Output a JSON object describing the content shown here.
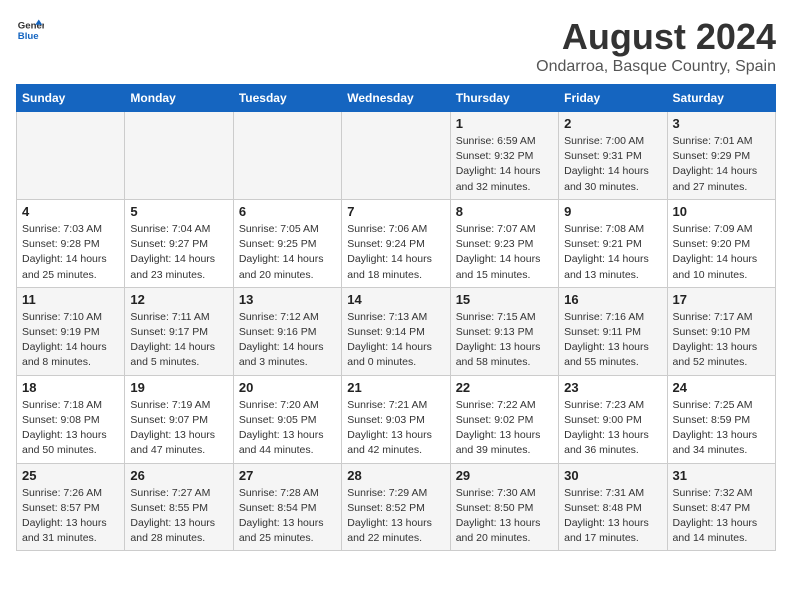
{
  "header": {
    "logo_general": "General",
    "logo_blue": "Blue",
    "title": "August 2024",
    "subtitle": "Ondarroa, Basque Country, Spain"
  },
  "days_of_week": [
    "Sunday",
    "Monday",
    "Tuesday",
    "Wednesday",
    "Thursday",
    "Friday",
    "Saturday"
  ],
  "weeks": [
    [
      {
        "day": "",
        "sunrise": "",
        "sunset": "",
        "daylight": "",
        "empty": true
      },
      {
        "day": "",
        "sunrise": "",
        "sunset": "",
        "daylight": "",
        "empty": true
      },
      {
        "day": "",
        "sunrise": "",
        "sunset": "",
        "daylight": "",
        "empty": true
      },
      {
        "day": "",
        "sunrise": "",
        "sunset": "",
        "daylight": "",
        "empty": true
      },
      {
        "day": "1",
        "sunrise": "Sunrise: 6:59 AM",
        "sunset": "Sunset: 9:32 PM",
        "daylight": "Daylight: 14 hours and 32 minutes."
      },
      {
        "day": "2",
        "sunrise": "Sunrise: 7:00 AM",
        "sunset": "Sunset: 9:31 PM",
        "daylight": "Daylight: 14 hours and 30 minutes."
      },
      {
        "day": "3",
        "sunrise": "Sunrise: 7:01 AM",
        "sunset": "Sunset: 9:29 PM",
        "daylight": "Daylight: 14 hours and 27 minutes."
      }
    ],
    [
      {
        "day": "4",
        "sunrise": "Sunrise: 7:03 AM",
        "sunset": "Sunset: 9:28 PM",
        "daylight": "Daylight: 14 hours and 25 minutes."
      },
      {
        "day": "5",
        "sunrise": "Sunrise: 7:04 AM",
        "sunset": "Sunset: 9:27 PM",
        "daylight": "Daylight: 14 hours and 23 minutes."
      },
      {
        "day": "6",
        "sunrise": "Sunrise: 7:05 AM",
        "sunset": "Sunset: 9:25 PM",
        "daylight": "Daylight: 14 hours and 20 minutes."
      },
      {
        "day": "7",
        "sunrise": "Sunrise: 7:06 AM",
        "sunset": "Sunset: 9:24 PM",
        "daylight": "Daylight: 14 hours and 18 minutes."
      },
      {
        "day": "8",
        "sunrise": "Sunrise: 7:07 AM",
        "sunset": "Sunset: 9:23 PM",
        "daylight": "Daylight: 14 hours and 15 minutes."
      },
      {
        "day": "9",
        "sunrise": "Sunrise: 7:08 AM",
        "sunset": "Sunset: 9:21 PM",
        "daylight": "Daylight: 14 hours and 13 minutes."
      },
      {
        "day": "10",
        "sunrise": "Sunrise: 7:09 AM",
        "sunset": "Sunset: 9:20 PM",
        "daylight": "Daylight: 14 hours and 10 minutes."
      }
    ],
    [
      {
        "day": "11",
        "sunrise": "Sunrise: 7:10 AM",
        "sunset": "Sunset: 9:19 PM",
        "daylight": "Daylight: 14 hours and 8 minutes."
      },
      {
        "day": "12",
        "sunrise": "Sunrise: 7:11 AM",
        "sunset": "Sunset: 9:17 PM",
        "daylight": "Daylight: 14 hours and 5 minutes."
      },
      {
        "day": "13",
        "sunrise": "Sunrise: 7:12 AM",
        "sunset": "Sunset: 9:16 PM",
        "daylight": "Daylight: 14 hours and 3 minutes."
      },
      {
        "day": "14",
        "sunrise": "Sunrise: 7:13 AM",
        "sunset": "Sunset: 9:14 PM",
        "daylight": "Daylight: 14 hours and 0 minutes."
      },
      {
        "day": "15",
        "sunrise": "Sunrise: 7:15 AM",
        "sunset": "Sunset: 9:13 PM",
        "daylight": "Daylight: 13 hours and 58 minutes."
      },
      {
        "day": "16",
        "sunrise": "Sunrise: 7:16 AM",
        "sunset": "Sunset: 9:11 PM",
        "daylight": "Daylight: 13 hours and 55 minutes."
      },
      {
        "day": "17",
        "sunrise": "Sunrise: 7:17 AM",
        "sunset": "Sunset: 9:10 PM",
        "daylight": "Daylight: 13 hours and 52 minutes."
      }
    ],
    [
      {
        "day": "18",
        "sunrise": "Sunrise: 7:18 AM",
        "sunset": "Sunset: 9:08 PM",
        "daylight": "Daylight: 13 hours and 50 minutes."
      },
      {
        "day": "19",
        "sunrise": "Sunrise: 7:19 AM",
        "sunset": "Sunset: 9:07 PM",
        "daylight": "Daylight: 13 hours and 47 minutes."
      },
      {
        "day": "20",
        "sunrise": "Sunrise: 7:20 AM",
        "sunset": "Sunset: 9:05 PM",
        "daylight": "Daylight: 13 hours and 44 minutes."
      },
      {
        "day": "21",
        "sunrise": "Sunrise: 7:21 AM",
        "sunset": "Sunset: 9:03 PM",
        "daylight": "Daylight: 13 hours and 42 minutes."
      },
      {
        "day": "22",
        "sunrise": "Sunrise: 7:22 AM",
        "sunset": "Sunset: 9:02 PM",
        "daylight": "Daylight: 13 hours and 39 minutes."
      },
      {
        "day": "23",
        "sunrise": "Sunrise: 7:23 AM",
        "sunset": "Sunset: 9:00 PM",
        "daylight": "Daylight: 13 hours and 36 minutes."
      },
      {
        "day": "24",
        "sunrise": "Sunrise: 7:25 AM",
        "sunset": "Sunset: 8:59 PM",
        "daylight": "Daylight: 13 hours and 34 minutes."
      }
    ],
    [
      {
        "day": "25",
        "sunrise": "Sunrise: 7:26 AM",
        "sunset": "Sunset: 8:57 PM",
        "daylight": "Daylight: 13 hours and 31 minutes."
      },
      {
        "day": "26",
        "sunrise": "Sunrise: 7:27 AM",
        "sunset": "Sunset: 8:55 PM",
        "daylight": "Daylight: 13 hours and 28 minutes."
      },
      {
        "day": "27",
        "sunrise": "Sunrise: 7:28 AM",
        "sunset": "Sunset: 8:54 PM",
        "daylight": "Daylight: 13 hours and 25 minutes."
      },
      {
        "day": "28",
        "sunrise": "Sunrise: 7:29 AM",
        "sunset": "Sunset: 8:52 PM",
        "daylight": "Daylight: 13 hours and 22 minutes."
      },
      {
        "day": "29",
        "sunrise": "Sunrise: 7:30 AM",
        "sunset": "Sunset: 8:50 PM",
        "daylight": "Daylight: 13 hours and 20 minutes."
      },
      {
        "day": "30",
        "sunrise": "Sunrise: 7:31 AM",
        "sunset": "Sunset: 8:48 PM",
        "daylight": "Daylight: 13 hours and 17 minutes."
      },
      {
        "day": "31",
        "sunrise": "Sunrise: 7:32 AM",
        "sunset": "Sunset: 8:47 PM",
        "daylight": "Daylight: 13 hours and 14 minutes."
      }
    ]
  ]
}
